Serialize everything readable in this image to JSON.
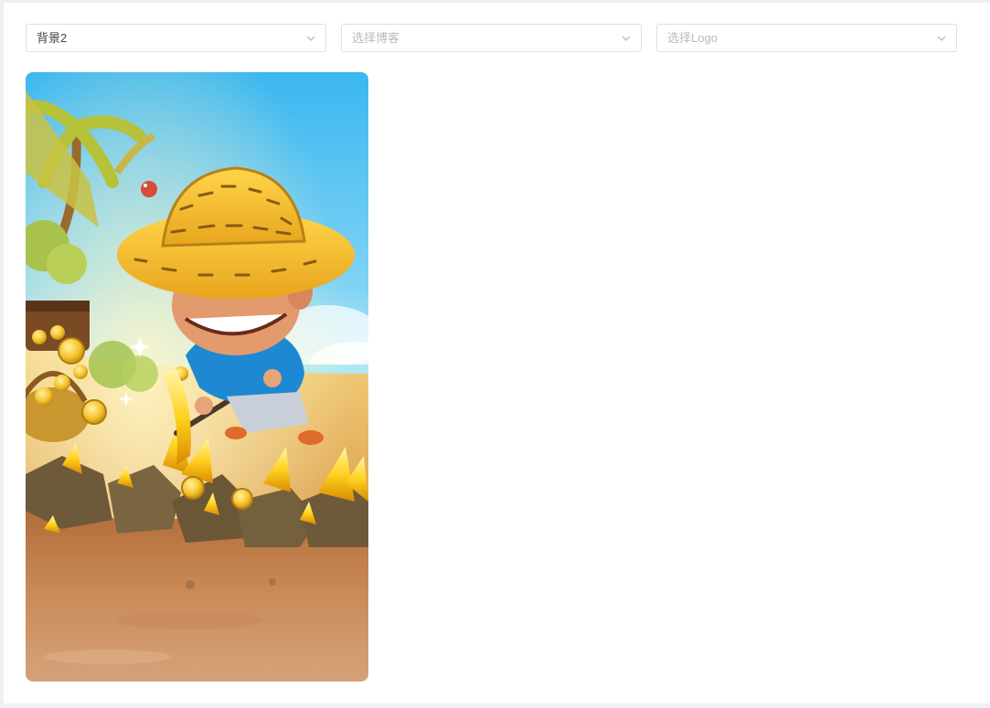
{
  "selects": [
    {
      "value": "背景2",
      "placeholder": "",
      "icon": "chevron-down-icon"
    },
    {
      "value": "",
      "placeholder": "选择博客",
      "icon": "chevron-down-icon"
    },
    {
      "value": "",
      "placeholder": "选择Logo",
      "icon": "chevron-down-icon"
    }
  ],
  "colors": {
    "border": "#dcdfe6",
    "placeholder": "#b7bac1",
    "text": "#444444",
    "page_bg": "#eef0f3"
  }
}
